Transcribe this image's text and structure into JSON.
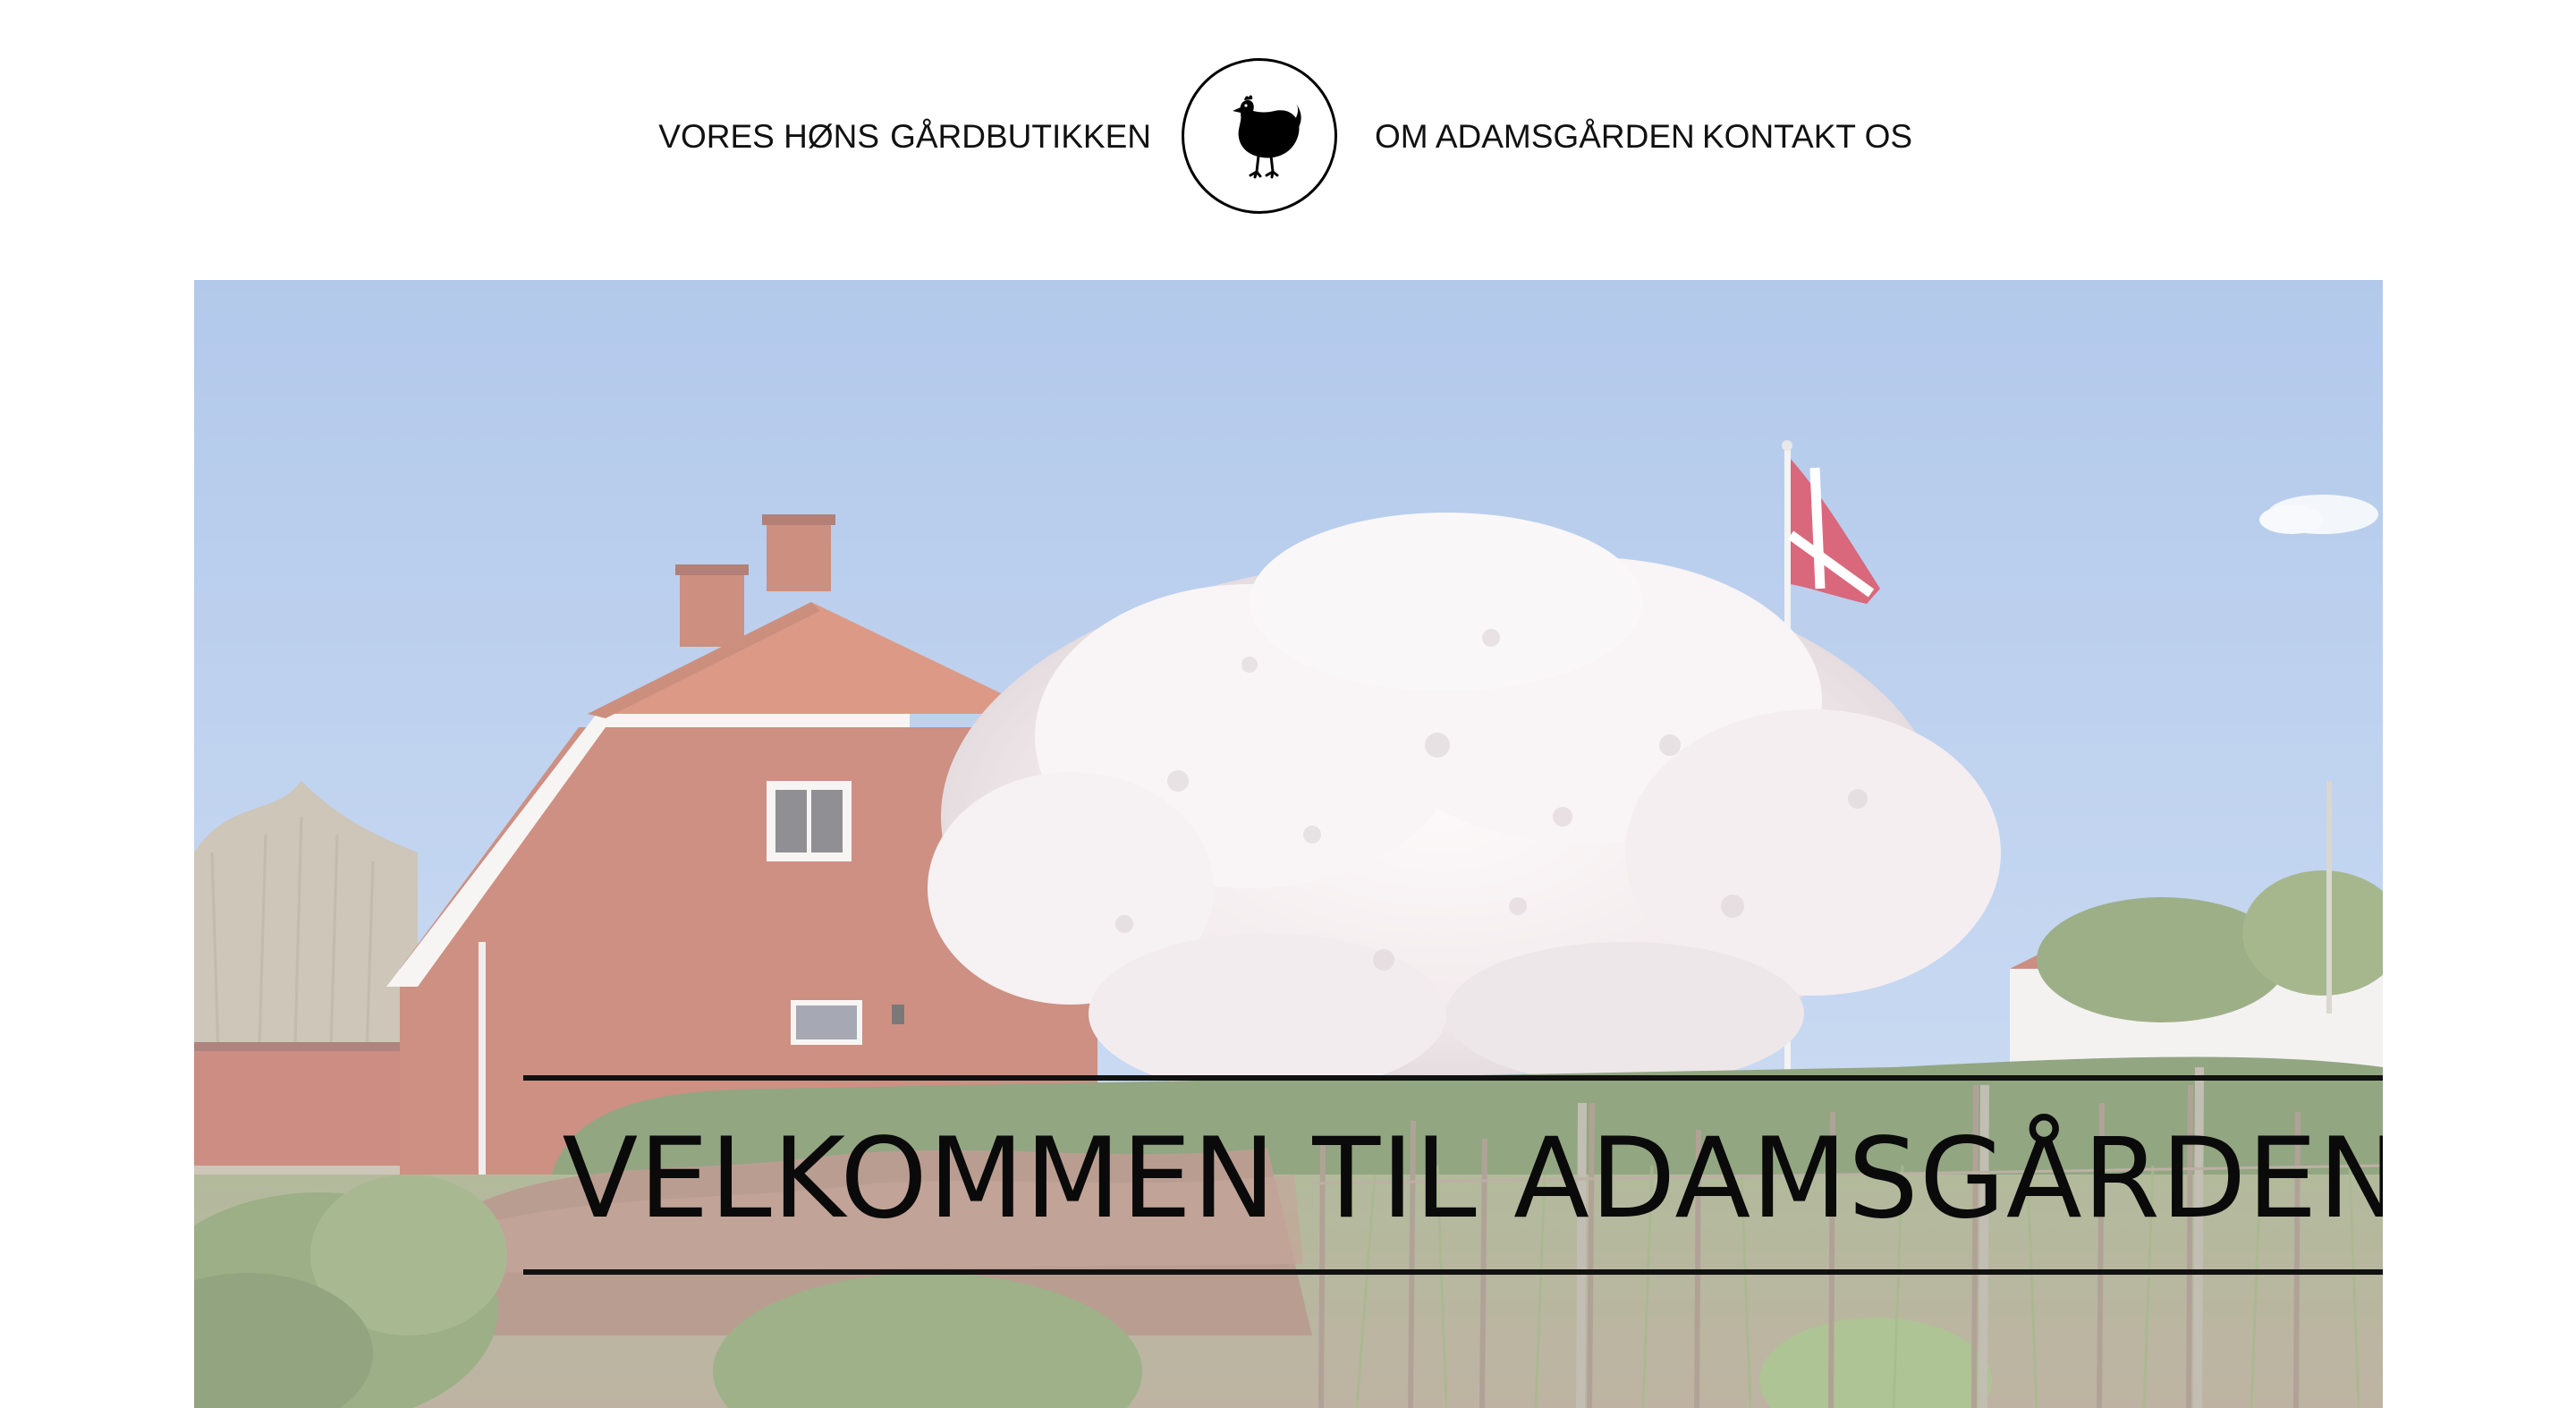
{
  "nav": {
    "left": [
      {
        "label": "VORES HØNS"
      },
      {
        "label": "GÅRDBUTIKKEN"
      }
    ],
    "right": [
      {
        "label": "OM ADAMSGÅRDEN"
      },
      {
        "label": "KONTAKT OS"
      }
    ],
    "logo_icon": "chicken-icon"
  },
  "hero": {
    "title": "VELKOMMEN TIL ADAMSGÅRDEN"
  },
  "colors": {
    "text": "#111111",
    "sky": "#9db8e4",
    "brick": "#b45a45",
    "roof": "#c8664a",
    "blossom": "#f4eef0",
    "flag_red": "#c8213f",
    "hedge": "#6f8a4f"
  }
}
